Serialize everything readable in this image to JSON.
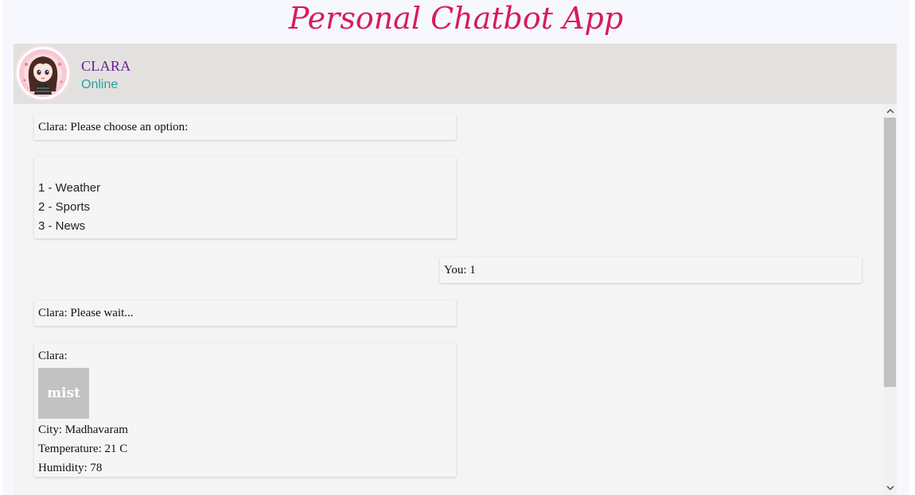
{
  "app": {
    "title": "Personal Chatbot App"
  },
  "contact": {
    "name": "CLARA",
    "status": "Online"
  },
  "messages": [
    {
      "sender": "bot",
      "text": "Clara: Please choose an option:"
    },
    {
      "sender": "bot",
      "options": [
        "1 - Weather",
        "2 - Sports",
        "3 - News"
      ]
    },
    {
      "sender": "user",
      "text": "You: 1"
    },
    {
      "sender": "bot",
      "text": "Clara: Please wait..."
    },
    {
      "sender": "bot",
      "label": "Clara:",
      "weather_icon_text": "mist",
      "city": "City: Madhavaram",
      "temperature": "Temperature: 21 C",
      "humidity": "Humidity: 78"
    }
  ],
  "colors": {
    "title": "#d81b60",
    "contact_name": "#6a1b9a",
    "status": "#26a0a0",
    "header_bg": "#e3e1df",
    "chat_bg": "#f4f4f4"
  },
  "scroll": {
    "position_fraction": 0.0
  }
}
